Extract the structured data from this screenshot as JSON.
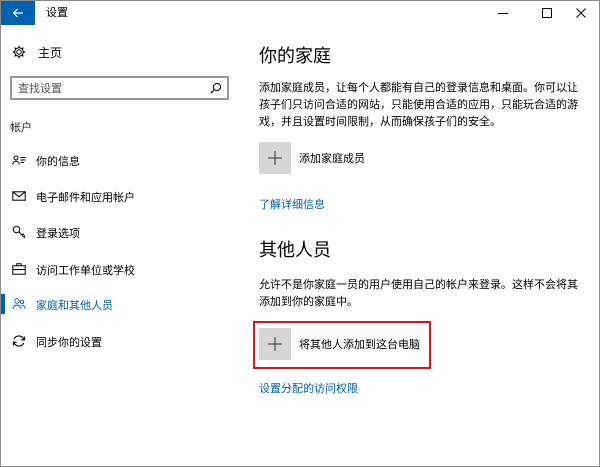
{
  "window": {
    "title": "设置",
    "back_icon": "back-arrow-icon",
    "controls": [
      "minimize-icon",
      "maximize-icon",
      "close-icon"
    ]
  },
  "sidebar": {
    "home_label": "主页",
    "home_icon": "gear-icon",
    "search_placeholder": "查找设置",
    "search_icon": "search-icon",
    "section_label": "帐户",
    "items": [
      {
        "label": "你的信息",
        "icon": "person-card-icon",
        "active": false
      },
      {
        "label": "电子邮件和应用帐户",
        "icon": "mail-icon",
        "active": false
      },
      {
        "label": "登录选项",
        "icon": "key-icon",
        "active": false
      },
      {
        "label": "访问工作单位或学校",
        "icon": "briefcase-icon",
        "active": false
      },
      {
        "label": "家庭和其他人员",
        "icon": "people-icon",
        "active": true
      },
      {
        "label": "同步你的设置",
        "icon": "sync-icon",
        "active": false
      }
    ]
  },
  "main": {
    "family": {
      "title": "你的家庭",
      "description": "添加家庭成员，让每个人都能有自己的登录信息和桌面。你可以让孩子们只访问合适的网站，只能使用合适的应用，只能玩合适的游戏，并且设置时间限制，从而确保孩子们的安全。",
      "add_label": "添加家庭成员",
      "link": "了解详细信息"
    },
    "others": {
      "title": "其他人员",
      "description": "允许不是你家庭一员的用户使用自己的帐户来登录。这样不会将其添加到你的家庭中。",
      "add_label": "将其他人添加到这台电脑",
      "link": "设置分配的访问权限"
    }
  },
  "colors": {
    "accent": "#0063b1",
    "highlight_border": "#d9141f",
    "tile": "#d6d6d6"
  }
}
